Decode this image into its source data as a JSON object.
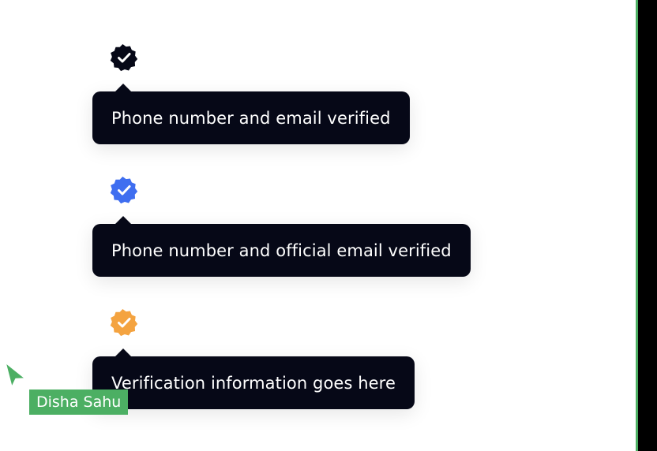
{
  "colors": {
    "tooltip_background": "#060817",
    "badge_dark": "#060817",
    "badge_blue": "#3f6ef0",
    "badge_orange": "#f4a340",
    "collaborator_green": "#4caf63"
  },
  "badges": [
    {
      "icon": "verified-badge-dark-icon",
      "color": "#060817",
      "tooltip": "Phone number and email verified"
    },
    {
      "icon": "verified-badge-blue-icon",
      "color": "#3f6ef0",
      "tooltip": "Phone number and official email verified"
    },
    {
      "icon": "verified-badge-orange-icon",
      "color": "#f4a340",
      "tooltip": "Verification information goes here"
    }
  ],
  "collaborator": {
    "name": "Disha Sahu",
    "icon": "cursor-pointer-icon"
  }
}
